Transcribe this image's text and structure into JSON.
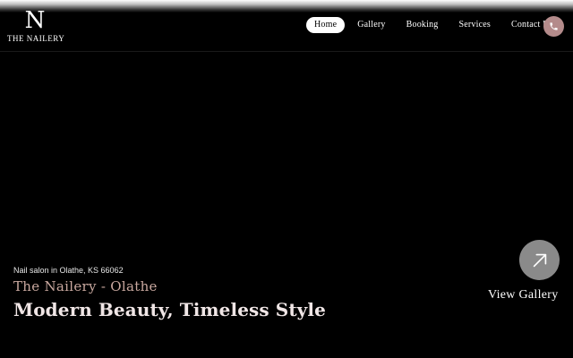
{
  "logo": {
    "mark": "N",
    "text": "THE NAILERY"
  },
  "nav": {
    "items": [
      {
        "label": "Home",
        "active": true
      },
      {
        "label": "Gallery",
        "active": false
      },
      {
        "label": "Booking",
        "active": false
      },
      {
        "label": "Services",
        "active": false
      },
      {
        "label": "Contact Us",
        "active": false
      }
    ]
  },
  "phone": {
    "icon": "phone-icon",
    "color": "#b48b8b"
  },
  "hero": {
    "subtitle": "Nail salon in Olathe, KS 66062",
    "brand": "The Nailery - Olathe",
    "title": "Modern Beauty, Timeless Style"
  },
  "gallery": {
    "label": "View Gallery",
    "icon": "arrow-up-right-icon"
  },
  "colors": {
    "accent": "#c9a89f",
    "phone_bg": "#b48b8b",
    "background": "#000000"
  }
}
